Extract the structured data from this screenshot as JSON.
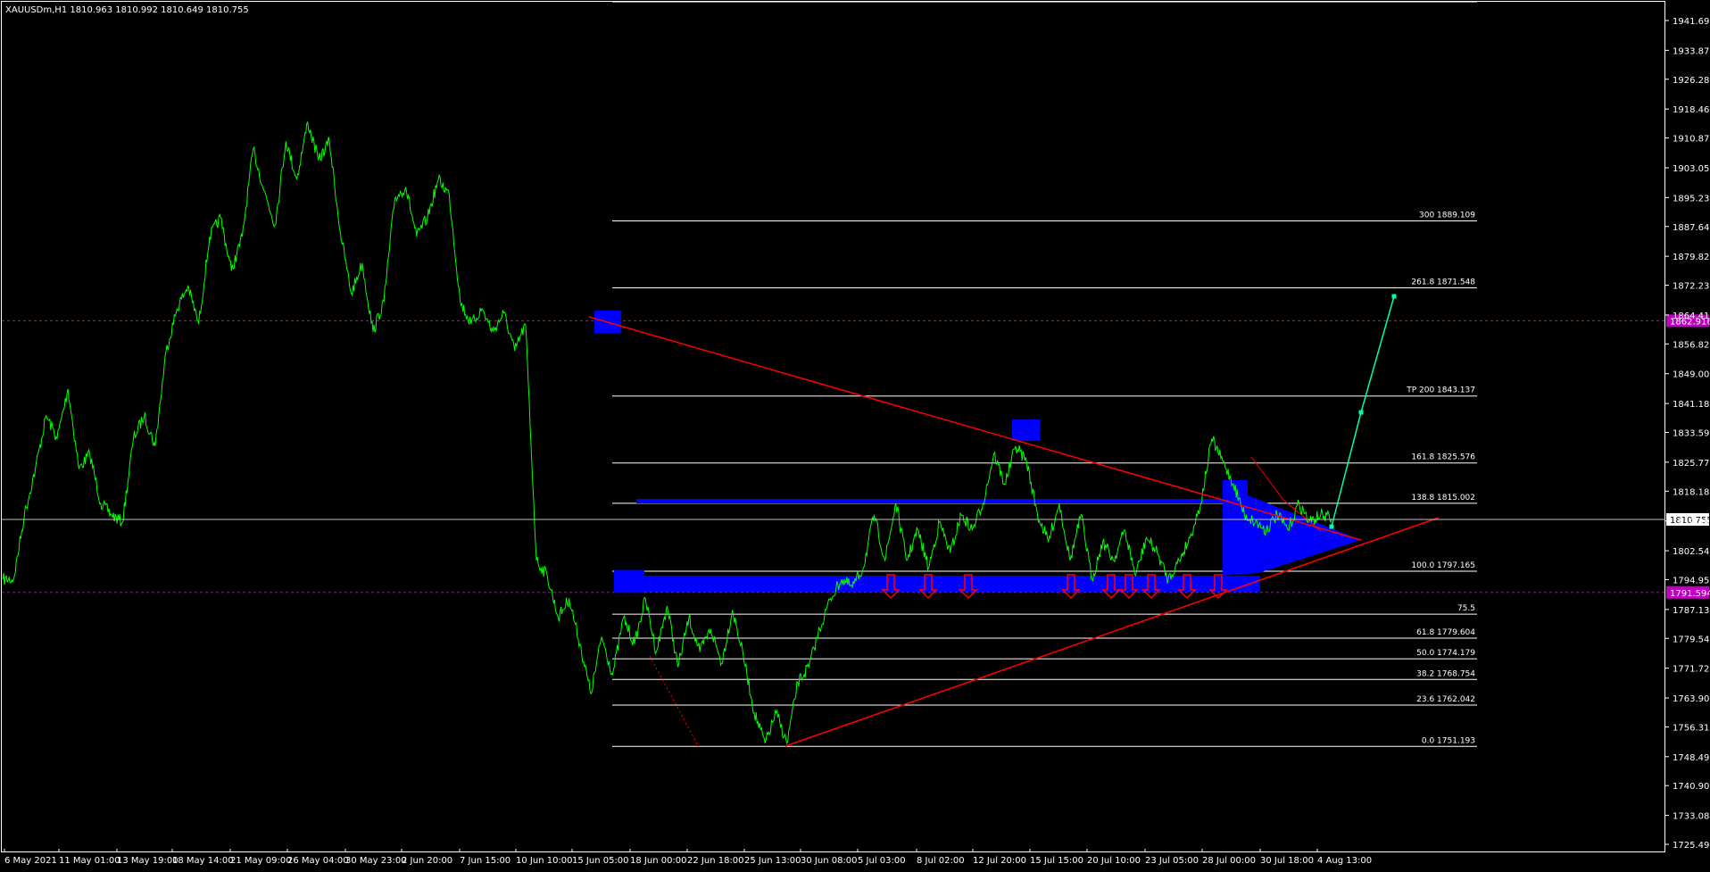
{
  "chart_data": {
    "type": "line",
    "title": "XAUUSDm,H1",
    "ohlc_header": "1810.963 1810.992 1810.649 1810.755",
    "current_price": 1810.755,
    "ylim": [
      1721.5,
      1951.5
    ],
    "y_ticks": [
      1941.69,
      1933.87,
      1926.28,
      1918.46,
      1910.87,
      1903.05,
      1895.23,
      1887.64,
      1879.82,
      1872.23,
      1864.41,
      1856.82,
      1849.0,
      1841.18,
      1833.59,
      1825.77,
      1818.18,
      1810.36,
      1802.54,
      1794.95,
      1787.13,
      1779.54,
      1771.72,
      1763.9,
      1756.31,
      1748.49,
      1740.9,
      1733.08,
      1725.49
    ],
    "y_tick_labels": [
      "1941.690",
      "1933.870",
      "1926.280",
      "1918.460",
      "1910.870",
      "1903.050",
      "1895.230",
      "1887.640",
      "1879.820",
      "1872.230",
      "1864.410",
      "1856.820",
      "1849.000",
      "1841.180",
      "1833.590",
      "1825.770",
      "1818.180",
      "1810.360",
      "1802.540",
      "1794.950",
      "1787.130",
      "1779.540",
      "1771.720",
      "1763.900",
      "1756.310",
      "1748.490",
      "1740.900",
      "1733.080",
      "1725.490"
    ],
    "x_tick_labels": [
      "6 May 2021",
      "11 May 01:00",
      "13 May 19:00",
      "18 May 14:00",
      "21 May 09:00",
      "26 May 04:00",
      "30 May 23:00",
      "2 Jun 20:00",
      "7 Jun 15:00",
      "10 Jun 10:00",
      "15 Jun 05:00",
      "18 Jun 00:00",
      "22 Jun 18:00",
      "25 Jun 13:00",
      "30 Jun 08:00",
      "5 Jul 03:00",
      "8 Jul 02:00",
      "12 Jul 20:00",
      "15 Jul 15:00",
      "20 Jul 10:00",
      "23 Jul 05:00",
      "28 Jul 00:00",
      "30 Jul 18:00",
      "4 Aug 13:00"
    ],
    "price_path": [
      [
        0,
        1795
      ],
      [
        1,
        1795
      ],
      [
        2,
        1812
      ],
      [
        3,
        1824
      ],
      [
        4,
        1838
      ],
      [
        5,
        1832
      ],
      [
        6,
        1845
      ],
      [
        7,
        1824
      ],
      [
        8,
        1828
      ],
      [
        9,
        1815
      ],
      [
        10,
        1812
      ],
      [
        11,
        1810
      ],
      [
        12,
        1832
      ],
      [
        13,
        1838
      ],
      [
        14,
        1830
      ],
      [
        15,
        1855
      ],
      [
        16,
        1866
      ],
      [
        17,
        1872
      ],
      [
        18,
        1862
      ],
      [
        19,
        1885
      ],
      [
        20,
        1890
      ],
      [
        21,
        1876
      ],
      [
        22,
        1885
      ],
      [
        23,
        1908
      ],
      [
        24,
        1897
      ],
      [
        25,
        1888
      ],
      [
        26,
        1910
      ],
      [
        27,
        1900
      ],
      [
        28,
        1915
      ],
      [
        29,
        1905
      ],
      [
        30,
        1910
      ],
      [
        31,
        1886
      ],
      [
        32,
        1870
      ],
      [
        33,
        1878
      ],
      [
        34,
        1860
      ],
      [
        35,
        1868
      ],
      [
        36,
        1895
      ],
      [
        37,
        1898
      ],
      [
        38,
        1885
      ],
      [
        39,
        1890
      ],
      [
        40,
        1900
      ],
      [
        41,
        1896
      ],
      [
        42,
        1868
      ],
      [
        43,
        1862
      ],
      [
        44,
        1866
      ],
      [
        45,
        1860
      ],
      [
        46,
        1865
      ],
      [
        47,
        1855
      ],
      [
        48,
        1862
      ],
      [
        49,
        1800
      ],
      [
        50,
        1796
      ],
      [
        51,
        1785
      ],
      [
        52,
        1790
      ],
      [
        53,
        1778
      ],
      [
        54,
        1765
      ],
      [
        55,
        1780
      ],
      [
        56,
        1770
      ],
      [
        57,
        1785
      ],
      [
        58,
        1778
      ],
      [
        59,
        1790
      ],
      [
        60,
        1776
      ],
      [
        61,
        1788
      ],
      [
        62,
        1772
      ],
      [
        63,
        1785
      ],
      [
        64,
        1776
      ],
      [
        65,
        1782
      ],
      [
        66,
        1773
      ],
      [
        67,
        1787
      ],
      [
        68,
        1775
      ],
      [
        69,
        1760
      ],
      [
        70,
        1752
      ],
      [
        71,
        1760
      ],
      [
        72,
        1752
      ],
      [
        73,
        1768
      ],
      [
        74,
        1772
      ],
      [
        75,
        1782
      ],
      [
        76,
        1790
      ],
      [
        77,
        1795
      ],
      [
        78,
        1793
      ],
      [
        79,
        1798
      ],
      [
        80,
        1812
      ],
      [
        81,
        1800
      ],
      [
        82,
        1815
      ],
      [
        83,
        1800
      ],
      [
        84,
        1808
      ],
      [
        85,
        1798
      ],
      [
        86,
        1810
      ],
      [
        87,
        1802
      ],
      [
        88,
        1812
      ],
      [
        89,
        1808
      ],
      [
        90,
        1815
      ],
      [
        91,
        1828
      ],
      [
        92,
        1820
      ],
      [
        93,
        1830
      ],
      [
        94,
        1826
      ],
      [
        95,
        1812
      ],
      [
        96,
        1805
      ],
      [
        97,
        1815
      ],
      [
        98,
        1800
      ],
      [
        99,
        1812
      ],
      [
        100,
        1795
      ],
      [
        101,
        1805
      ],
      [
        102,
        1800
      ],
      [
        103,
        1808
      ],
      [
        104,
        1796
      ],
      [
        105,
        1806
      ],
      [
        106,
        1802
      ],
      [
        107,
        1795
      ],
      [
        108,
        1800
      ],
      [
        109,
        1806
      ],
      [
        110,
        1815
      ],
      [
        111,
        1832
      ],
      [
        112,
        1826
      ],
      [
        113,
        1820
      ],
      [
        114,
        1812
      ],
      [
        115,
        1810
      ],
      [
        116,
        1808
      ],
      [
        117,
        1812
      ],
      [
        118,
        1808
      ],
      [
        119,
        1815
      ],
      [
        120,
        1810
      ],
      [
        121,
        1812
      ],
      [
        122,
        1811
      ]
    ],
    "hlines": [
      {
        "label": "",
        "value": 1952.0
      },
      {
        "label": "300 1889.109",
        "value": 1889.109
      },
      {
        "label": "261.8 1871.548",
        "value": 1871.548
      },
      {
        "label": "TP 200 1843.137",
        "value": 1843.137
      },
      {
        "label": "161.8 1825.576",
        "value": 1825.576
      },
      {
        "label": "138.8 1815.002",
        "value": 1815.002
      },
      {
        "label": "100.0 1797.165",
        "value": 1797.165
      },
      {
        "label": "75.5",
        "value": 1785.9
      },
      {
        "label": "61.8 1779.604",
        "value": 1779.604
      },
      {
        "label": "50.0 1774.179",
        "value": 1774.179
      },
      {
        "label": "38.2 1768.754",
        "value": 1768.754
      },
      {
        "label": "23.6 1762.042",
        "value": 1762.042
      },
      {
        "label": "0.0 1751.193",
        "value": 1751.193
      }
    ],
    "dashed_levels": [
      {
        "value": 1862.9,
        "label": "1862.916"
      },
      {
        "value": 1791.6,
        "label": "1791.594"
      }
    ],
    "current_price_label": "1810.755",
    "colors": {
      "background": "#000000",
      "price": "#00ff00",
      "trendline": "#ff0000",
      "zones": "#0000ff",
      "projection": "#00ffaa",
      "dashed": "#c000c0",
      "level_lines": "#ffffff",
      "text": "#ffffff"
    }
  }
}
